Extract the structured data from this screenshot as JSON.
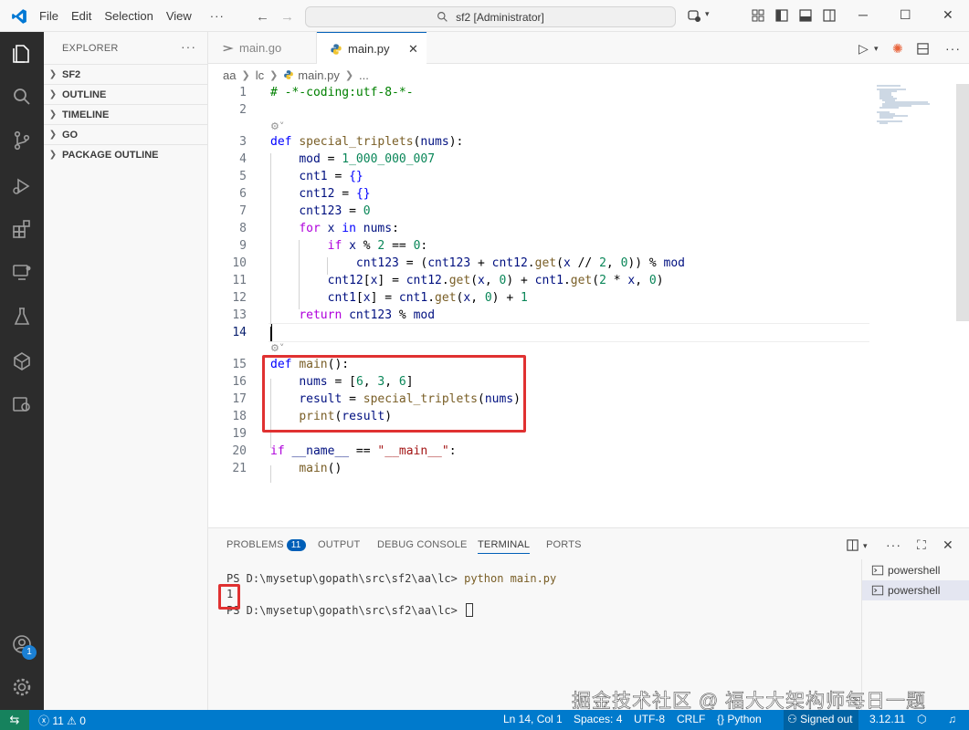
{
  "titlebar": {
    "menus": [
      "File",
      "Edit",
      "Selection",
      "View"
    ],
    "more": "···",
    "command_center": "sf2 [Administrator]"
  },
  "sidebar": {
    "title": "EXPLORER",
    "more": "···",
    "sections": [
      "SF2",
      "OUTLINE",
      "TIMELINE",
      "GO",
      "PACKAGE OUTLINE"
    ]
  },
  "activity": {
    "accounts_badge": "1"
  },
  "tabs": [
    {
      "label": "main.go",
      "active": false
    },
    {
      "label": "main.py",
      "active": true
    }
  ],
  "breadcrumb": [
    "aa",
    "lc",
    "main.py",
    "..."
  ],
  "editor": {
    "current_line": 14,
    "lines": [
      {
        "n": "1"
      },
      {
        "n": "2"
      },
      {
        "n": "3"
      },
      {
        "n": "4"
      },
      {
        "n": "5"
      },
      {
        "n": "6"
      },
      {
        "n": "7"
      },
      {
        "n": "8"
      },
      {
        "n": "9"
      },
      {
        "n": "10"
      },
      {
        "n": "11"
      },
      {
        "n": "12"
      },
      {
        "n": "13"
      },
      {
        "n": "14"
      },
      {
        "n": "15"
      },
      {
        "n": "16"
      },
      {
        "n": "17"
      },
      {
        "n": "18"
      },
      {
        "n": "19"
      },
      {
        "n": "20"
      },
      {
        "n": "21"
      }
    ]
  },
  "panel": {
    "tabs": [
      "PROBLEMS",
      "OUTPUT",
      "DEBUG CONSOLE",
      "TERMINAL",
      "PORTS"
    ],
    "problems_count": "11",
    "active_tab": "TERMINAL",
    "terminal_lines": [
      {
        "prompt": "PS D:\\mysetup\\gopath\\src\\sf2\\aa\\lc> ",
        "command": "python main.py"
      },
      {
        "prompt": "1",
        "command": ""
      },
      {
        "prompt": "PS D:\\mysetup\\gopath\\src\\sf2\\aa\\lc> ",
        "command": ""
      }
    ],
    "terminals": [
      "powershell",
      "powershell"
    ]
  },
  "watermark": "掘金技术社区 @ 福大大架构师每日一题",
  "statusbar": {
    "errors": "11",
    "warnings": "0",
    "position": "Ln 14, Col 1",
    "spaces": "Spaces: 4",
    "encoding": "UTF-8",
    "eol": "CRLF",
    "language": "Python",
    "account": "Signed out",
    "interpreter": "3.12.11"
  },
  "colors": {
    "statusbar_bg": "#007acc",
    "activitybar_bg": "#2c2c2c",
    "highlight_box": "#e03131",
    "accent": "#005fb8"
  }
}
